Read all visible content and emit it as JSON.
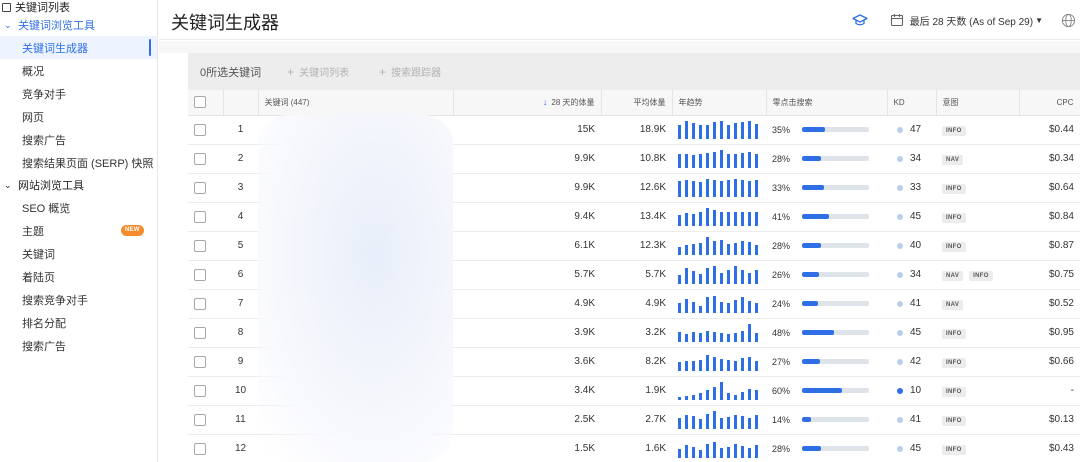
{
  "sidebar": {
    "top_item": "关键词列表",
    "groups": [
      {
        "title": "关键词浏览工具",
        "active": true,
        "items": [
          {
            "label": "关键词生成器",
            "active": true
          },
          {
            "label": "概况"
          },
          {
            "label": "竞争对手"
          },
          {
            "label": "网页"
          },
          {
            "label": "搜索广告"
          },
          {
            "label": "搜索结果页面 (SERP) 快照"
          }
        ]
      },
      {
        "title": "网站浏览工具",
        "items": [
          {
            "label": "SEO 概览"
          },
          {
            "label": "主题",
            "badge": "NEW"
          },
          {
            "label": "关键词"
          },
          {
            "label": "着陆页"
          },
          {
            "label": "搜索竞争对手"
          },
          {
            "label": "排名分配"
          },
          {
            "label": "搜索广告"
          }
        ]
      }
    ]
  },
  "header": {
    "title": "关键词生成器",
    "date_range": "最后 28 天数 (As of Sep 29)",
    "icons": [
      "graduation-cap-icon",
      "calendar-icon",
      "caret-down-icon",
      "globe-icon"
    ]
  },
  "toolbar": {
    "selected": "0所选关键词",
    "add_to_list": "关键词列表",
    "add_to_tracker": "搜索跟踪器"
  },
  "table": {
    "columns": {
      "keyword": "关键词 (447)",
      "volume28": "28 天的体量",
      "avg_volume": "平均体量",
      "trend": "年趋势",
      "zero_click": "零点击搜索",
      "kd": "KD",
      "intent": "意图",
      "cpc": "CPC"
    },
    "rows": [
      {
        "idx": "1",
        "vol": "15K",
        "avg": "18.9K",
        "zc": "35%",
        "zc_pct": 35,
        "kd": "47",
        "kd_easy": false,
        "intent": [
          "INFO"
        ],
        "cpc": "$0.44",
        "trend": [
          0.8,
          1.0,
          0.9,
          0.75,
          0.8,
          0.95,
          1.0,
          0.75,
          0.9,
          0.95,
          1.0,
          0.85
        ]
      },
      {
        "idx": "2",
        "vol": "9.9K",
        "avg": "10.8K",
        "zc": "28%",
        "zc_pct": 28,
        "kd": "34",
        "kd_easy": false,
        "intent": [
          "NAV"
        ],
        "cpc": "$0.34",
        "trend": [
          0.75,
          0.8,
          0.7,
          0.75,
          0.85,
          0.9,
          1.0,
          0.75,
          0.8,
          0.85,
          0.9,
          0.8
        ]
      },
      {
        "idx": "3",
        "vol": "9.9K",
        "avg": "12.6K",
        "zc": "33%",
        "zc_pct": 33,
        "kd": "33",
        "kd_easy": false,
        "intent": [
          "INFO"
        ],
        "cpc": "$0.64",
        "trend": [
          0.9,
          0.95,
          0.9,
          0.85,
          1.0,
          0.95,
          0.9,
          0.95,
          1.0,
          0.95,
          0.9,
          0.95
        ]
      },
      {
        "idx": "4",
        "vol": "9.4K",
        "avg": "13.4K",
        "zc": "41%",
        "zc_pct": 41,
        "kd": "45",
        "kd_easy": false,
        "intent": [
          "INFO"
        ],
        "cpc": "$0.84",
        "trend": [
          0.6,
          0.7,
          0.65,
          0.75,
          1.0,
          0.9,
          0.8,
          0.75,
          0.8,
          0.75,
          0.8,
          0.75
        ]
      },
      {
        "idx": "5",
        "vol": "6.1K",
        "avg": "12.3K",
        "zc": "28%",
        "zc_pct": 28,
        "kd": "40",
        "kd_easy": false,
        "intent": [
          "INFO"
        ],
        "cpc": "$0.87",
        "trend": [
          0.45,
          0.55,
          0.6,
          0.65,
          1.0,
          0.75,
          0.85,
          0.6,
          0.65,
          0.8,
          0.7,
          0.55
        ]
      },
      {
        "idx": "6",
        "vol": "5.7K",
        "avg": "5.7K",
        "zc": "26%",
        "zc_pct": 26,
        "kd": "34",
        "kd_easy": false,
        "intent": [
          "NAV",
          "INFO"
        ],
        "cpc": "$0.75",
        "trend": [
          0.5,
          0.9,
          0.7,
          0.55,
          0.9,
          1.0,
          0.6,
          0.75,
          1.0,
          0.75,
          0.6,
          0.75
        ]
      },
      {
        "idx": "7",
        "vol": "4.9K",
        "avg": "4.9K",
        "zc": "24%",
        "zc_pct": 24,
        "kd": "41",
        "kd_easy": false,
        "intent": [
          "NAV"
        ],
        "cpc": "$0.52",
        "trend": [
          0.55,
          0.8,
          0.6,
          0.4,
          0.9,
          0.95,
          0.6,
          0.55,
          0.7,
          0.9,
          0.65,
          0.55
        ]
      },
      {
        "idx": "8",
        "vol": "3.9K",
        "avg": "3.2K",
        "zc": "48%",
        "zc_pct": 48,
        "kd": "45",
        "kd_easy": false,
        "intent": [
          "INFO"
        ],
        "cpc": "$0.95",
        "trend": [
          0.55,
          0.45,
          0.55,
          0.5,
          0.6,
          0.55,
          0.5,
          0.45,
          0.5,
          0.6,
          1.0,
          0.5
        ]
      },
      {
        "idx": "9",
        "vol": "3.6K",
        "avg": "8.2K",
        "zc": "27%",
        "zc_pct": 27,
        "kd": "42",
        "kd_easy": false,
        "intent": [
          "INFO"
        ],
        "cpc": "$0.66",
        "trend": [
          0.5,
          0.55,
          0.55,
          0.6,
          0.9,
          0.75,
          0.65,
          0.6,
          0.55,
          0.7,
          0.75,
          0.55
        ]
      },
      {
        "idx": "10",
        "vol": "3.4K",
        "avg": "1.9K",
        "zc": "60%",
        "zc_pct": 60,
        "kd": "10",
        "kd_easy": true,
        "intent": [
          "INFO"
        ],
        "cpc": "-",
        "trend": [
          0.15,
          0.2,
          0.3,
          0.4,
          0.55,
          0.7,
          1.0,
          0.4,
          0.3,
          0.45,
          0.6,
          0.55
        ]
      },
      {
        "idx": "11",
        "vol": "2.5K",
        "avg": "2.7K",
        "zc": "14%",
        "zc_pct": 14,
        "kd": "41",
        "kd_easy": false,
        "intent": [
          "INFO"
        ],
        "cpc": "$0.13",
        "trend": [
          0.6,
          0.75,
          0.7,
          0.55,
          0.85,
          1.0,
          0.6,
          0.65,
          0.8,
          0.7,
          0.6,
          0.75
        ]
      },
      {
        "idx": "12",
        "vol": "1.5K",
        "avg": "1.6K",
        "zc": "28%",
        "zc_pct": 28,
        "kd": "45",
        "kd_easy": false,
        "intent": [
          "INFO"
        ],
        "cpc": "$0.43",
        "trend": [
          0.5,
          0.7,
          0.6,
          0.45,
          0.8,
          0.9,
          0.55,
          0.6,
          0.75,
          0.65,
          0.55,
          0.7
        ]
      }
    ]
  },
  "colors": {
    "accent": "#2f6fe6",
    "badge_new": "#f58b2b",
    "kd_easy": "#2f6fe6",
    "kd_medium": "#b9cfea"
  }
}
